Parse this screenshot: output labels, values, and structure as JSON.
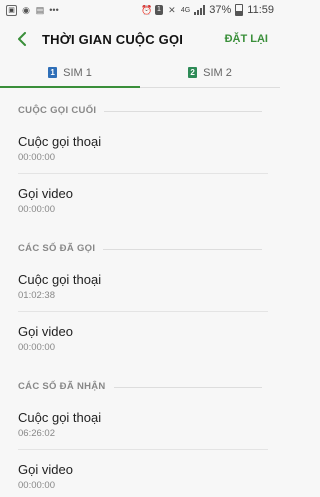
{
  "status_bar": {
    "battery_text": "37%",
    "time": "11:59",
    "network": "4G"
  },
  "header": {
    "title": "THỜI GIAN CUỘC GỌI",
    "reset_label": "ĐẶT LẠI"
  },
  "tabs": [
    {
      "label": "SIM 1",
      "badge": "1"
    },
    {
      "label": "SIM 2",
      "badge": "2"
    }
  ],
  "sections": [
    {
      "title": "CUỘC GỌI CUỐI",
      "items": [
        {
          "label": "Cuộc gọi thoại",
          "value": "00:00:00"
        },
        {
          "label": "Gọi video",
          "value": "00:00:00"
        }
      ]
    },
    {
      "title": "CÁC SỐ ĐÃ GỌI",
      "items": [
        {
          "label": "Cuộc gọi thoại",
          "value": "01:02:38"
        },
        {
          "label": "Gọi video",
          "value": "00:00:00"
        }
      ]
    },
    {
      "title": "CÁC SỐ ĐÃ NHẬN",
      "items": [
        {
          "label": "Cuộc gọi thoại",
          "value": "06:26:02"
        },
        {
          "label": "Gọi video",
          "value": "00:00:00"
        }
      ]
    }
  ],
  "colors": {
    "accent": "#3a8f3a",
    "sim1": "#2f6fb8",
    "sim2": "#2e8b57"
  }
}
